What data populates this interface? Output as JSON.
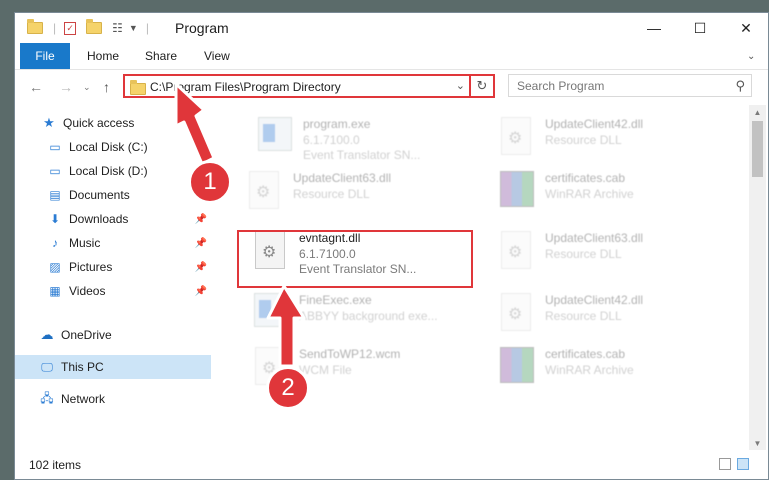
{
  "window": {
    "title": "Program",
    "controls": {
      "minimize": "—",
      "maximize": "☐",
      "close": "✕"
    }
  },
  "ribbon": {
    "tabs": [
      "File",
      "Home",
      "Share",
      "View"
    ]
  },
  "address": {
    "path": "C:\\Program Files\\Program Directory",
    "search_placeholder": "Search Program"
  },
  "nav_pane": {
    "quick_access": "Quick access",
    "items": [
      {
        "label": "Local Disk (C:)",
        "icon": "drive-icon",
        "pinned": false
      },
      {
        "label": "Local Disk (D:)",
        "icon": "drive-icon",
        "pinned": false
      },
      {
        "label": "Documents",
        "icon": "documents-icon",
        "pinned": false
      },
      {
        "label": "Downloads",
        "icon": "downloads-icon",
        "pinned": true
      },
      {
        "label": "Music",
        "icon": "music-icon",
        "pinned": true
      },
      {
        "label": "Pictures",
        "icon": "pictures-icon",
        "pinned": true
      },
      {
        "label": "Videos",
        "icon": "videos-icon",
        "pinned": true
      }
    ],
    "onedrive": "OneDrive",
    "this_pc": "This PC",
    "network": "Network"
  },
  "files": [
    {
      "name": "program.exe",
      "line2": "6.1.7100.0",
      "line3": "Event Translator SN...",
      "type": "exe",
      "faded": true
    },
    {
      "name": "UpdateClient42.dll",
      "line2": "Resource DLL",
      "line3": "",
      "type": "dll",
      "faded": true
    },
    {
      "name": "UpdateClient63.dll",
      "line2": "Resource DLL",
      "line3": "",
      "type": "dll",
      "faded": true
    },
    {
      "name": "certificates.cab",
      "line2": "WinRAR Archive",
      "line3": "",
      "type": "rar",
      "faded": true
    },
    {
      "name": "evntagnt.dll",
      "line2": "6.1.7100.0",
      "line3": "Event Translator SN...",
      "type": "dll",
      "faded": false
    },
    {
      "name": "UpdateClient63.dll",
      "line2": "Resource DLL",
      "line3": "",
      "type": "dll",
      "faded": true
    },
    {
      "name": "FineExec.exe",
      "line2": "ABBYY background exe...",
      "line3": "",
      "type": "exe",
      "faded": true
    },
    {
      "name": "UpdateClient42.dll",
      "line2": "Resource DLL",
      "line3": "",
      "type": "dll",
      "faded": true
    },
    {
      "name": "SendToWP12.wcm",
      "line2": "WCM File",
      "line3": "",
      "type": "dll",
      "faded": true
    },
    {
      "name": "certificates.cab",
      "line2": "WinRAR Archive",
      "line3": "",
      "type": "rar",
      "faded": true
    }
  ],
  "status": {
    "items_count": "102 items"
  },
  "annotations": {
    "callout_1": "1",
    "callout_2": "2",
    "color": "#e0363a"
  }
}
